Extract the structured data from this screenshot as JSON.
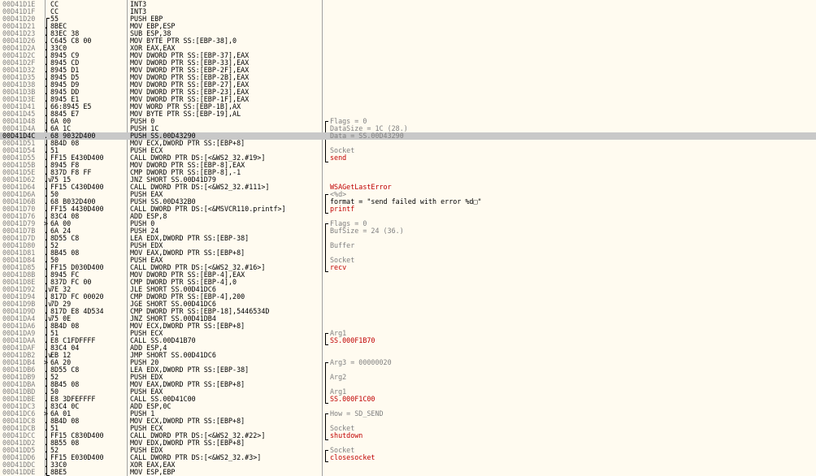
{
  "rows": [
    {
      "addr": "00D41D1E",
      "mark": "",
      "hex": "CC",
      "asm": "INT3",
      "cmt": ""
    },
    {
      "addr": "00D41D1F",
      "mark": "",
      "hex": "CC",
      "asm": "INT3",
      "cmt": ""
    },
    {
      "addr": "00D41D20",
      "mark": "",
      "hex": "55",
      "asm": "PUSH EBP",
      "cmt": ""
    },
    {
      "addr": "00D41D21",
      "mark": ".",
      "hex": "8BEC",
      "asm": "MOV EBP,ESP",
      "cmt": ""
    },
    {
      "addr": "00D41D23",
      "mark": ".",
      "hex": "83EC 38",
      "asm": "SUB ESP,38",
      "cmt": ""
    },
    {
      "addr": "00D41D26",
      "mark": ".",
      "hex": "C645 C8 00",
      "asm": "MOV BYTE PTR SS:[EBP-38],0",
      "cmt": ""
    },
    {
      "addr": "00D41D2A",
      "mark": ".",
      "hex": "33C0",
      "asm": "XOR EAX,EAX",
      "cmt": ""
    },
    {
      "addr": "00D41D2C",
      "mark": ".",
      "hex": "8945 C9",
      "asm": "MOV DWORD PTR SS:[EBP-37],EAX",
      "cmt": ""
    },
    {
      "addr": "00D41D2F",
      "mark": ".",
      "hex": "8945 CD",
      "asm": "MOV DWORD PTR SS:[EBP-33],EAX",
      "cmt": ""
    },
    {
      "addr": "00D41D32",
      "mark": ".",
      "hex": "8945 D1",
      "asm": "MOV DWORD PTR SS:[EBP-2F],EAX",
      "cmt": ""
    },
    {
      "addr": "00D41D35",
      "mark": ".",
      "hex": "8945 D5",
      "asm": "MOV DWORD PTR SS:[EBP-2B],EAX",
      "cmt": ""
    },
    {
      "addr": "00D41D38",
      "mark": ".",
      "hex": "8945 D9",
      "asm": "MOV DWORD PTR SS:[EBP-27],EAX",
      "cmt": ""
    },
    {
      "addr": "00D41D3B",
      "mark": ".",
      "hex": "8945 DD",
      "asm": "MOV DWORD PTR SS:[EBP-23],EAX",
      "cmt": ""
    },
    {
      "addr": "00D41D3E",
      "mark": ".",
      "hex": "8945 E1",
      "asm": "MOV DWORD PTR SS:[EBP-1F],EAX",
      "cmt": ""
    },
    {
      "addr": "00D41D41",
      "mark": ".",
      "hex": "66:8945 E5",
      "asm": "MOV WORD PTR SS:[EBP-1B],AX",
      "cmt": ""
    },
    {
      "addr": "00D41D45",
      "mark": ".",
      "hex": "8845 E7",
      "asm": "MOV BYTE PTR SS:[EBP-19],AL",
      "cmt": ""
    },
    {
      "addr": "00D41D48",
      "mark": ".",
      "hex": "6A 00",
      "asm": "PUSH 0",
      "cmt": "Flags = 0"
    },
    {
      "addr": "00D41D4A",
      "mark": ".",
      "hex": "6A 1C",
      "asm": "PUSH 1C",
      "cmt": "DataSize = 1C (28.)"
    },
    {
      "addr": "00D41D4C",
      "mark": ".",
      "hex": "68 9032D400",
      "asm": "PUSH SS.00D43290",
      "cmt": "Data = SS.00D43290",
      "selected": true
    },
    {
      "addr": "00D41D51",
      "mark": ".",
      "hex": "8B4D 08",
      "asm": "MOV ECX,DWORD PTR SS:[EBP+8]",
      "cmt": ""
    },
    {
      "addr": "00D41D54",
      "mark": ".",
      "hex": "51",
      "asm": "PUSH ECX",
      "cmt": "Socket"
    },
    {
      "addr": "00D41D55",
      "mark": ".",
      "hex": "FF15 E430D400",
      "asm": "CALL DWORD PTR DS:[<&WS2_32.#19>]",
      "cmt": "send",
      "func": true
    },
    {
      "addr": "00D41D5B",
      "mark": ".",
      "hex": "8945 F8",
      "asm": "MOV DWORD PTR SS:[EBP-8],EAX",
      "cmt": ""
    },
    {
      "addr": "00D41D5E",
      "mark": ".",
      "hex": "837D F8 FF",
      "asm": "CMP DWORD PTR SS:[EBP-8],-1",
      "cmt": ""
    },
    {
      "addr": "00D41D62",
      "mark": ".v",
      "hex": "75 15",
      "asm": "JNZ SHORT SS.00D41D79",
      "cmt": ""
    },
    {
      "addr": "00D41D64",
      "mark": ".",
      "hex": "FF15 C430D400",
      "asm": "CALL DWORD PTR DS:[<&WS2_32.#111>]",
      "cmt": "WSAGetLastError",
      "func": true
    },
    {
      "addr": "00D41D6A",
      "mark": ".",
      "hex": "50",
      "asm": "PUSH EAX",
      "cmt": "<%d>"
    },
    {
      "addr": "00D41D6B",
      "mark": ".",
      "hex": "68 B032D400",
      "asm": "PUSH SS.00D432B0",
      "cmt": "format = \"send failed with error %d□\"",
      "str": true
    },
    {
      "addr": "00D41D70",
      "mark": ".",
      "hex": "FF15 4430D400",
      "asm": "CALL DWORD PTR DS:[<&MSVCR110.printf>]",
      "cmt": "printf",
      "func": true
    },
    {
      "addr": "00D41D76",
      "mark": ".",
      "hex": "83C4 08",
      "asm": "ADD ESP,8",
      "cmt": ""
    },
    {
      "addr": "00D41D79",
      "mark": ">",
      "hex": "6A 00",
      "asm": "PUSH 0",
      "cmt": "Flags = 0"
    },
    {
      "addr": "00D41D7B",
      "mark": ".",
      "hex": "6A 24",
      "asm": "PUSH 24",
      "cmt": "BufSize = 24 (36.)"
    },
    {
      "addr": "00D41D7D",
      "mark": ".",
      "hex": "8D55 C8",
      "asm": "LEA EDX,DWORD PTR SS:[EBP-38]",
      "cmt": ""
    },
    {
      "addr": "00D41D80",
      "mark": ".",
      "hex": "52",
      "asm": "PUSH EDX",
      "cmt": "Buffer"
    },
    {
      "addr": "00D41D81",
      "mark": ".",
      "hex": "8B45 08",
      "asm": "MOV EAX,DWORD PTR SS:[EBP+8]",
      "cmt": ""
    },
    {
      "addr": "00D41D84",
      "mark": ".",
      "hex": "50",
      "asm": "PUSH EAX",
      "cmt": "Socket"
    },
    {
      "addr": "00D41D85",
      "mark": ".",
      "hex": "FF15 D030D400",
      "asm": "CALL DWORD PTR DS:[<&WS2_32.#16>]",
      "cmt": "recv",
      "func": true
    },
    {
      "addr": "00D41D8B",
      "mark": ".",
      "hex": "8945 FC",
      "asm": "MOV DWORD PTR SS:[EBP-4],EAX",
      "cmt": ""
    },
    {
      "addr": "00D41D8E",
      "mark": ".",
      "hex": "837D FC 00",
      "asm": "CMP DWORD PTR SS:[EBP-4],0",
      "cmt": ""
    },
    {
      "addr": "00D41D92",
      "mark": ".v",
      "hex": "7E 32",
      "asm": "JLE SHORT SS.00D41DC6",
      "cmt": ""
    },
    {
      "addr": "00D41D94",
      "mark": ".",
      "hex": "817D FC 00020",
      "asm": "CMP DWORD PTR SS:[EBP-4],200",
      "cmt": ""
    },
    {
      "addr": "00D41D9B",
      "mark": ".v",
      "hex": "7D 29",
      "asm": "JGE SHORT SS.00D41DC6",
      "cmt": ""
    },
    {
      "addr": "00D41D9D",
      "mark": ".",
      "hex": "817D E8 4D534",
      "asm": "CMP DWORD PTR SS:[EBP-18],5446534D",
      "cmt": ""
    },
    {
      "addr": "00D41DA4",
      "mark": ".v",
      "hex": "75 0E",
      "asm": "JNZ SHORT SS.00D41DB4",
      "cmt": ""
    },
    {
      "addr": "00D41DA6",
      "mark": ".",
      "hex": "8B4D 08",
      "asm": "MOV ECX,DWORD PTR SS:[EBP+8]",
      "cmt": ""
    },
    {
      "addr": "00D41DA9",
      "mark": ".",
      "hex": "51",
      "asm": "PUSH ECX",
      "cmt": "Arg1"
    },
    {
      "addr": "00D41DAA",
      "mark": ".",
      "hex": "E8 C1FDFFFF",
      "asm": "CALL SS.00D41B70",
      "cmt": "SS.000F1B70",
      "func": true
    },
    {
      "addr": "00D41DAF",
      "mark": ".",
      "hex": "83C4 04",
      "asm": "ADD ESP,4",
      "cmt": ""
    },
    {
      "addr": "00D41DB2",
      "mark": ".v",
      "hex": "EB 12",
      "asm": "JMP SHORT SS.00D41DC6",
      "cmt": ""
    },
    {
      "addr": "00D41DB4",
      "mark": ">",
      "hex": "6A 20",
      "asm": "PUSH 20",
      "cmt": "Arg3 = 00000020"
    },
    {
      "addr": "00D41DB6",
      "mark": ".",
      "hex": "8D55 C8",
      "asm": "LEA EDX,DWORD PTR SS:[EBP-38]",
      "cmt": ""
    },
    {
      "addr": "00D41DB9",
      "mark": ".",
      "hex": "52",
      "asm": "PUSH EDX",
      "cmt": "Arg2"
    },
    {
      "addr": "00D41DBA",
      "mark": ".",
      "hex": "8B45 08",
      "asm": "MOV EAX,DWORD PTR SS:[EBP+8]",
      "cmt": ""
    },
    {
      "addr": "00D41DBD",
      "mark": ".",
      "hex": "50",
      "asm": "PUSH EAX",
      "cmt": "Arg1"
    },
    {
      "addr": "00D41DBE",
      "mark": ".",
      "hex": "E8 3DFEFFFF",
      "asm": "CALL SS.00D41C00",
      "cmt": "SS.000F1C00",
      "func": true
    },
    {
      "addr": "00D41DC3",
      "mark": ".",
      "hex": "83C4 0C",
      "asm": "ADD ESP,0C",
      "cmt": ""
    },
    {
      "addr": "00D41DC6",
      "mark": ">",
      "hex": "6A 01",
      "asm": "PUSH 1",
      "cmt": "How = SD_SEND"
    },
    {
      "addr": "00D41DC8",
      "mark": ".",
      "hex": "8B4D 08",
      "asm": "MOV ECX,DWORD PTR SS:[EBP+8]",
      "cmt": ""
    },
    {
      "addr": "00D41DCB",
      "mark": ".",
      "hex": "51",
      "asm": "PUSH ECX",
      "cmt": "Socket"
    },
    {
      "addr": "00D41DCC",
      "mark": ".",
      "hex": "FF15 C830D400",
      "asm": "CALL DWORD PTR DS:[<&WS2_32.#22>]",
      "cmt": "shutdown",
      "func": true
    },
    {
      "addr": "00D41DD2",
      "mark": ".",
      "hex": "8B55 08",
      "asm": "MOV EDX,DWORD PTR SS:[EBP+8]",
      "cmt": ""
    },
    {
      "addr": "00D41DD5",
      "mark": ".",
      "hex": "52",
      "asm": "PUSH EDX",
      "cmt": "Socket"
    },
    {
      "addr": "00D41DD6",
      "mark": ".",
      "hex": "FF15 E030D400",
      "asm": "CALL DWORD PTR DS:[<&WS2_32.#3>]",
      "cmt": "closesocket",
      "func": true
    },
    {
      "addr": "00D41DDC",
      "mark": ".",
      "hex": "33C0",
      "asm": "XOR EAX,EAX",
      "cmt": ""
    },
    {
      "addr": "00D41DDE",
      "mark": ".",
      "hex": "8BE5",
      "asm": "MOV ESP,EBP",
      "cmt": ""
    }
  ],
  "colors": {
    "background": "#fffbf0",
    "selection": "#c8c8c8",
    "address": "#808080",
    "function_comment": "#c00000",
    "comment": "#808080"
  }
}
